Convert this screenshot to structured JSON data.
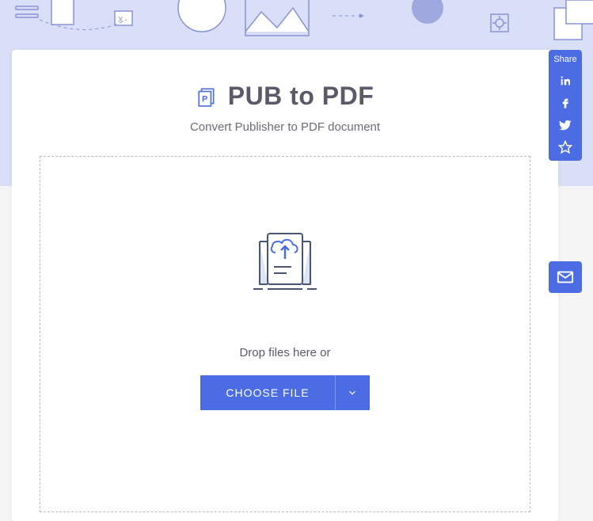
{
  "page": {
    "title": "PUB to PDF",
    "subtitle": "Convert Publisher to PDF document"
  },
  "dropzone": {
    "drop_text": "Drop files here or",
    "choose_label": "CHOOSE FILE"
  },
  "share": {
    "label": "Share",
    "items": [
      "linkedin",
      "facebook",
      "twitter",
      "favorite"
    ]
  },
  "colors": {
    "accent": "#4b6ce3",
    "hero_bg": "#d9dff7",
    "text": "#5a5a68"
  }
}
